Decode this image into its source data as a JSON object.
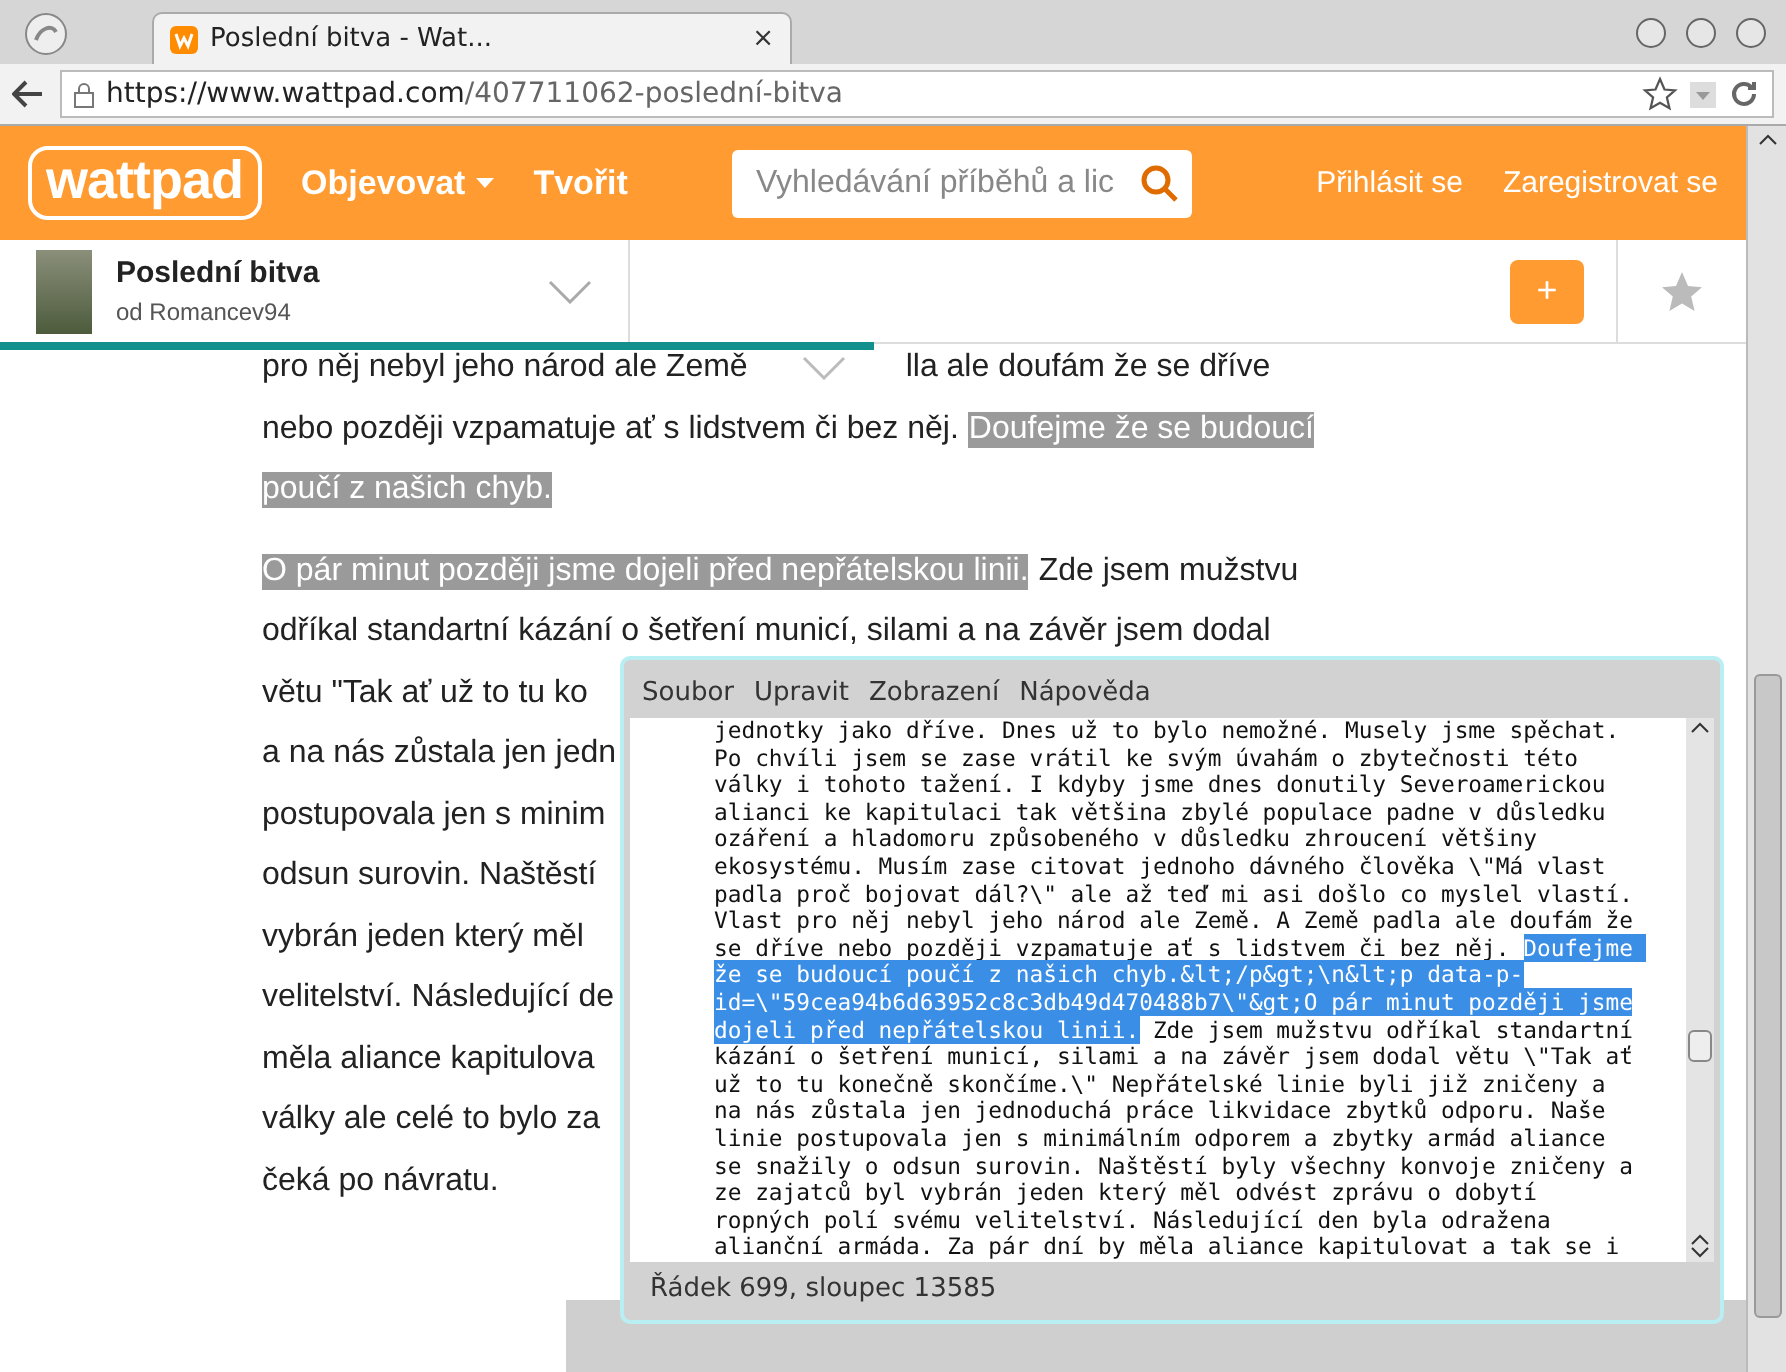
{
  "browser": {
    "tab": {
      "title": "Poslední bitva - Wat...",
      "close": "×",
      "selected": true
    },
    "url_host": "https://www.wattpad.com",
    "url_path": "/407711062-poslední-bitva"
  },
  "header": {
    "logo": "wattpad",
    "nav": [
      {
        "label": "Objevovat",
        "dropdown": true
      },
      {
        "label": "Tvořit",
        "dropdown": false
      }
    ],
    "search": {
      "placeholder": "Vyhledávání příběhů a lic"
    },
    "actions": [
      "Přihlásit se",
      "Zaregistrovat se"
    ]
  },
  "story": {
    "title": "Poslední bitva",
    "author": "od Romancev94",
    "add": "+",
    "level": 0.5
  },
  "article": {
    "paragraphs": [
      {
        "lines": [
          {
            "obscured": true,
            "segments": [
              {
                "text": "pro něj nebyl jeho národ ale Země",
                "highlighted": false
              },
              {
                "text": "lla ale doufám že se dříve",
                "highlighted": false
              }
            ]
          },
          {
            "obscured": false,
            "segments": [
              {
                "text": "nebo později vzpamatuje ať s lidstvem či bez něj.",
                "highlighted": false
              },
              {
                "text": "Doufejme že se budoucí",
                "highlighted": true
              }
            ]
          },
          {
            "obscured": false,
            "segments": [
              {
                "text": "poučí z našich chyb.",
                "highlighted": true
              }
            ]
          }
        ]
      },
      {
        "lines": [
          {
            "obscured": false,
            "segments": [
              {
                "text": "O pár minut později jsme dojeli před nepřátelskou linii.",
                "highlighted": true
              },
              {
                "text": "Zde jsem mužstvu",
                "highlighted": false
              }
            ]
          },
          {
            "obscured": false,
            "segments": [
              {
                "text": "odříkal standartní kázání o šetření municí, silami a na závěr jsem dodal",
                "highlighted": false
              }
            ]
          },
          {
            "obscured": false,
            "segments": [
              {
                "text": "větu \"Tak ať už to tu ko",
                "highlighted": false
              }
            ]
          },
          {
            "obscured": false,
            "segments": [
              {
                "text": "a na nás zůstala jen jedn",
                "highlighted": false
              }
            ]
          },
          {
            "obscured": false,
            "segments": [
              {
                "text": "postupovala jen s minim",
                "highlighted": false
              }
            ]
          },
          {
            "obscured": false,
            "segments": [
              {
                "text": "odsun surovin. Naštěstí",
                "highlighted": false
              }
            ]
          },
          {
            "obscured": false,
            "segments": [
              {
                "text": "vybrán jeden který měl",
                "highlighted": false
              }
            ]
          },
          {
            "obscured": false,
            "segments": [
              {
                "text": "velitelství. Následující de",
                "highlighted": false
              }
            ]
          },
          {
            "obscured": false,
            "segments": [
              {
                "text": "měla aliance kapitulova",
                "highlighted": false
              }
            ]
          },
          {
            "obscured": false,
            "segments": [
              {
                "text": "války ale celé to bylo za",
                "highlighted": false
              }
            ]
          },
          {
            "obscured": false,
            "segments": [
              {
                "text": "čeká po návratu.",
                "highlighted": false
              }
            ]
          }
        ]
      }
    ]
  },
  "editor": {
    "menu": [
      "Soubor",
      "Upravit",
      "Zobrazení",
      "Nápověda"
    ],
    "lines": [
      [
        {
          "text": "jednotky jako dříve. Dnes už to bylo nemožné. Musely jsme spěchat.",
          "selected": false
        }
      ],
      [
        {
          "text": "Po chvíli jsem se zase vrátil ke svým úvahám o zbytečnosti této",
          "selected": false
        }
      ],
      [
        {
          "text": "války i tohoto tažení. I kdyby jsme dnes donutily Severoamerickou",
          "selected": false
        }
      ],
      [
        {
          "text": "alianci ke kapitulaci tak většina zbylé populace padne v důsledku",
          "selected": false
        }
      ],
      [
        {
          "text": "ozáření a hladomoru způsobeného v důsledku zhroucení většiny",
          "selected": false
        }
      ],
      [
        {
          "text": "ekosystému. Musím zase citovat jednoho dávného člověka \\\"Má vlast",
          "selected": false
        }
      ],
      [
        {
          "text": "padla proč bojovat dál?\\\" ale až teď mi asi došlo co myslel vlastí.",
          "selected": false
        }
      ],
      [
        {
          "text": "Vlast pro něj nebyl jeho národ ale Země. A Země padla ale doufám že",
          "selected": false
        }
      ],
      [
        {
          "text": "se dříve nebo později vzpamatuje ať s lidstvem či bez něj. ",
          "selected": false
        },
        {
          "text": "Doufejme ",
          "selected": true
        }
      ],
      [
        {
          "text": "že se budoucí poučí z našich chyb.&lt;/p&gt;\\n&lt;p data-p-",
          "selected": true
        }
      ],
      [
        {
          "text": "id=\\\"59cea94b6d63952c8c3db49d470488b7\\\"&gt;O pár minut později jsme",
          "selected": true
        }
      ],
      [
        {
          "text": "dojeli před nepřátelskou linii.",
          "selected": true
        },
        {
          "text": " Zde jsem mužstvu odříkal standartní",
          "selected": false
        }
      ],
      [
        {
          "text": "kázání o šetření municí, silami a na závěr jsem dodal větu \\\"Tak ať",
          "selected": false
        }
      ],
      [
        {
          "text": "už to tu konečně skončíme.\\\" Nepřátelské linie byli již zničeny a",
          "selected": false
        }
      ],
      [
        {
          "text": "na nás zůstala jen jednoduchá práce likvidace zbytků odporu. Naše",
          "selected": false
        }
      ],
      [
        {
          "text": "linie postupovala jen s minimálním odporem a zbytky armád aliance",
          "selected": false
        }
      ],
      [
        {
          "text": "se snažily o odsun surovin. Naštěstí byly všechny konvoje zničeny a",
          "selected": false
        }
      ],
      [
        {
          "text": "ze zajatců byl vybrán jeden který měl odvést zprávu o dobytí",
          "selected": false
        }
      ],
      [
        {
          "text": "ropných polí svému velitelství. Následující den byla odražena",
          "selected": false
        }
      ],
      [
        {
          "text": "alianční armáda. Za pár dní by měla aliance kapitulovat a tak se i",
          "selected": false
        }
      ]
    ],
    "status": "Řádek 699, sloupec 13585"
  }
}
